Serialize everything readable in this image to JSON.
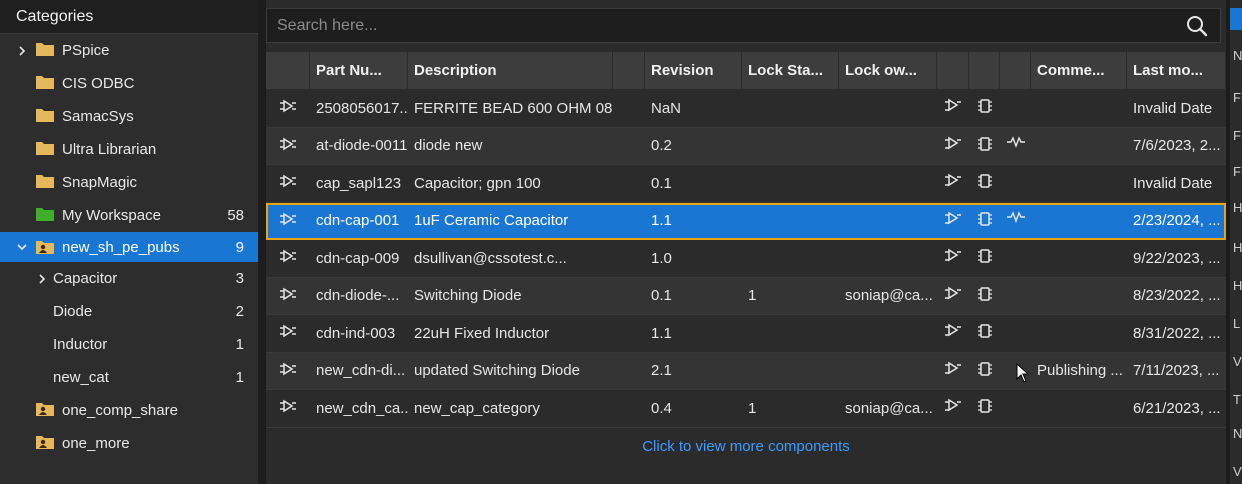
{
  "categories": {
    "header": "Categories",
    "items": [
      {
        "label": "PSpice",
        "count": "",
        "expand": "collapsed",
        "folder": "yellow"
      },
      {
        "label": "CIS ODBC",
        "count": "",
        "expand": "none",
        "folder": "yellow"
      },
      {
        "label": "SamacSys",
        "count": "",
        "expand": "none",
        "folder": "yellow"
      },
      {
        "label": "Ultra Librarian",
        "count": "",
        "expand": "none",
        "folder": "yellow"
      },
      {
        "label": "SnapMagic",
        "count": "",
        "expand": "none",
        "folder": "yellow"
      },
      {
        "label": "My Workspace",
        "count": "58",
        "expand": "none",
        "folder": "green"
      },
      {
        "label": "new_sh_pe_pubs",
        "count": "9",
        "expand": "expanded",
        "folder": "shared",
        "selected": true
      },
      {
        "label": "Capacitor",
        "count": "3",
        "expand": "collapsed",
        "folder": "none",
        "child": true
      },
      {
        "label": "Diode",
        "count": "2",
        "expand": "none",
        "folder": "none",
        "child": true
      },
      {
        "label": "Inductor",
        "count": "1",
        "expand": "none",
        "folder": "none",
        "child": true
      },
      {
        "label": "new_cat",
        "count": "1",
        "expand": "none",
        "folder": "none",
        "child": true
      },
      {
        "label": "one_comp_share",
        "count": "",
        "expand": "none",
        "folder": "shared"
      },
      {
        "label": "one_more",
        "count": "",
        "expand": "none",
        "folder": "shared"
      }
    ]
  },
  "search": {
    "placeholder": "Search here..."
  },
  "table": {
    "headers": [
      "",
      "Part Nu...",
      "Description",
      "",
      "Revision",
      "Lock Sta...",
      "Lock ow...",
      "",
      "",
      "",
      "Comme...",
      "Last mo..."
    ],
    "rows": [
      {
        "part": "2508056017...",
        "desc": "FERRITE BEAD 600 OHM 08...",
        "rev": "NaN",
        "lock_status": "",
        "lock_owner": "",
        "sim": false,
        "comment": "",
        "modified": "Invalid Date"
      },
      {
        "part": "at-diode-0011",
        "desc": "diode new",
        "rev": "0.2",
        "lock_status": "",
        "lock_owner": "",
        "sim": true,
        "comment": "",
        "modified": "7/6/2023, 2..."
      },
      {
        "part": "cap_sapl123",
        "desc": "Capacitor; gpn 100",
        "rev": "0.1",
        "lock_status": "",
        "lock_owner": "",
        "sim": false,
        "comment": "",
        "modified": "Invalid Date"
      },
      {
        "part": "cdn-cap-001",
        "desc": "1uF Ceramic Capacitor",
        "rev": "1.1",
        "lock_status": "",
        "lock_owner": "",
        "sim": true,
        "comment": "",
        "modified": "2/23/2024, ...",
        "selected": true
      },
      {
        "part": "cdn-cap-009",
        "desc": "dsullivan@cssotest.c...",
        "rev": "1.0",
        "lock_status": "",
        "lock_owner": "",
        "sim": false,
        "comment": "",
        "modified": "9/22/2023, ..."
      },
      {
        "part": "cdn-diode-...",
        "desc": "Switching Diode",
        "rev": "0.1",
        "lock_status": "1",
        "lock_owner": "soniap@ca...",
        "sim": false,
        "comment": "",
        "modified": "8/23/2022, ..."
      },
      {
        "part": "cdn-ind-003",
        "desc": "22uH Fixed Inductor",
        "rev": "1.1",
        "lock_status": "",
        "lock_owner": "",
        "sim": false,
        "comment": "",
        "modified": "8/31/2022, ..."
      },
      {
        "part": "new_cdn-di...",
        "desc": "updated Switching Diode",
        "rev": "2.1",
        "lock_status": "",
        "lock_owner": "",
        "sim": false,
        "comment": "Publishing ...",
        "modified": "7/11/2023, ..."
      },
      {
        "part": "new_cdn_ca...",
        "desc": "new_cap_category",
        "rev": "0.4",
        "lock_status": "1",
        "lock_owner": "soniap@ca...",
        "sim": false,
        "comment": "",
        "modified": "6/21/2023, ..."
      }
    ],
    "more_link": "Click to view more components"
  },
  "right_panel": {
    "letters": [
      "N",
      "F",
      "F",
      "F",
      "H",
      "H",
      "H",
      "L",
      "V",
      "T",
      "N",
      "V"
    ]
  },
  "colors": {
    "accent": "#1976d2",
    "selection_outline": "#e8a317",
    "link": "#3d9bff",
    "folder_yellow": "#e6b85c",
    "folder_green": "#3fae2a"
  }
}
